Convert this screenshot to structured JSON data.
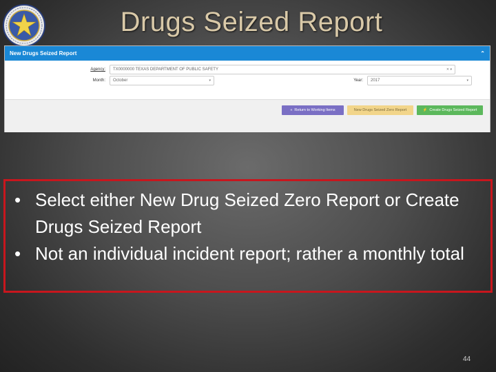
{
  "slide": {
    "title": "Drugs Seized Report",
    "page_number": "44"
  },
  "panel": {
    "title": "New Drugs Seized Report",
    "collapse_icon": "chevron-up-icon",
    "agency_label": "Agency:",
    "agency_value": "TX0000000 TEXAS DEPARTMENT OF PUBLIC SAFETY",
    "month_label": "Month:",
    "month_value": "October",
    "year_label": "Year:",
    "year_value": "2017",
    "buttons": {
      "return": "Return to Working Items",
      "zero": "New Drugs Seized Zero Report",
      "create": "Create Drugs Seized Report"
    },
    "colors": {
      "header": "#1a88d6",
      "return_btn": "#7a6fc4",
      "zero_btn": "#f2d58a",
      "create_btn": "#5cb85c"
    }
  },
  "bullets": [
    "Select either New Drug Seized Zero Report or Create Drugs Seized Report",
    "Not an individual incident report; rather a monthly total"
  ]
}
